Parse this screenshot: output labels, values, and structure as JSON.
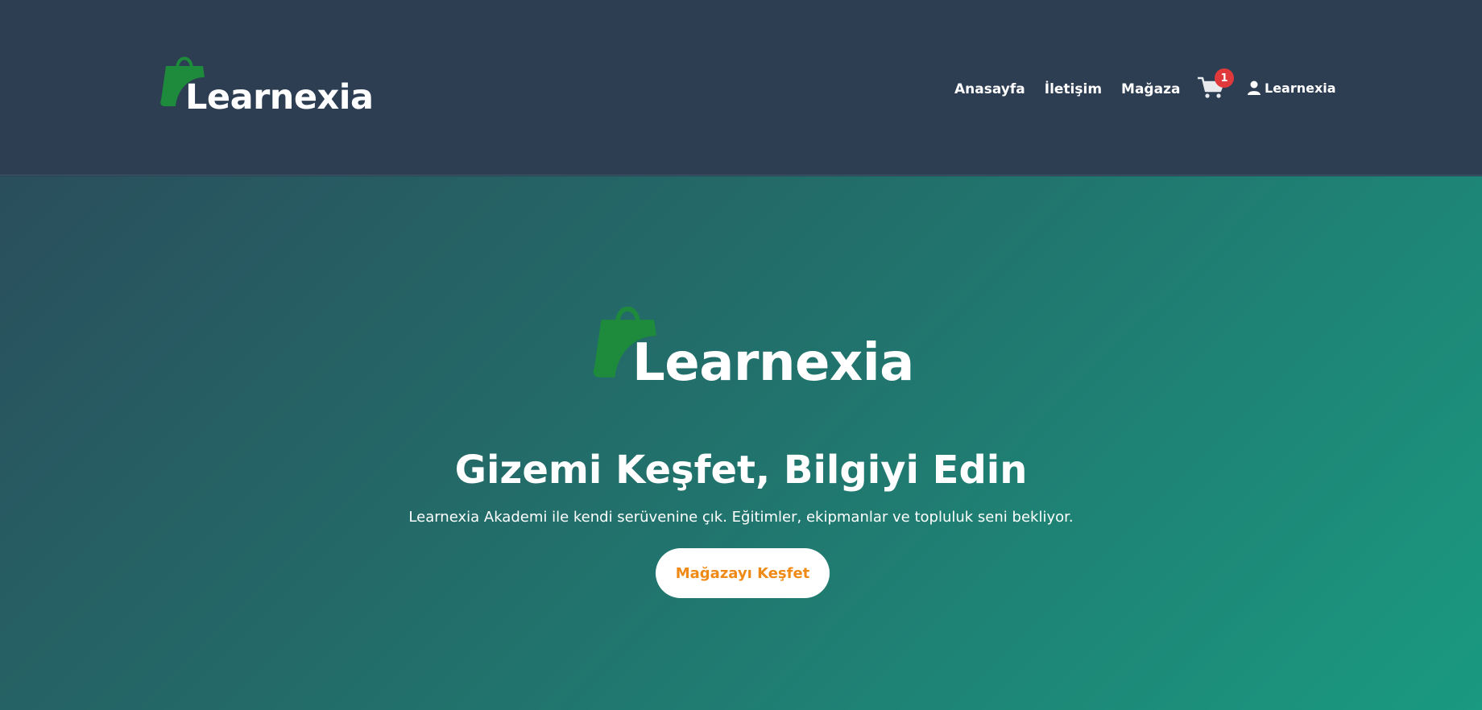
{
  "brand": {
    "name": "Learnexia",
    "logo_color": "#1e8a3c"
  },
  "nav": {
    "items": [
      "Anasayfa",
      "İletişim",
      "Mağaza"
    ]
  },
  "cart": {
    "icon": "shopping-cart-icon",
    "count": "1",
    "badge_color": "#e0393b"
  },
  "user": {
    "icon": "user-icon",
    "label": "Learnexia"
  },
  "hero": {
    "title": "Gizemi Keşfet, Bilgiyi Edin",
    "subtitle": "Learnexia Akademi ile kendi serüvenine çık. Eğitimler, ekipmanlar ve topluluk seni bekliyor.",
    "button_label": "Mağazayı Keşfet",
    "button_text_color": "#f08a16"
  },
  "colors": {
    "header_bg": "#2d3d52",
    "hero_gradient_start": "#2a4e5c",
    "hero_gradient_end": "#1a9a80"
  }
}
